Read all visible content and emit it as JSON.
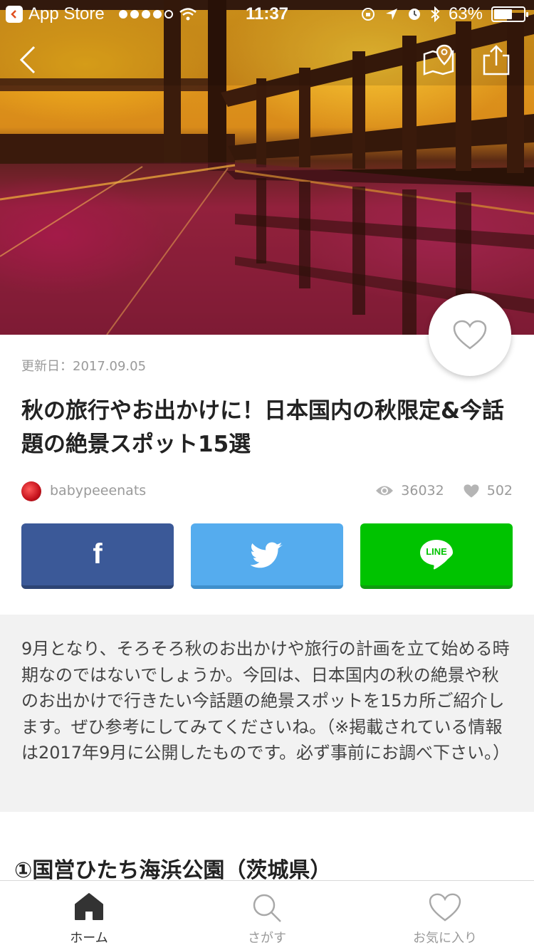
{
  "status_bar": {
    "carrier": "App Store",
    "time": "11:37",
    "battery": "63%",
    "battery_level": 0.63
  },
  "icons": {
    "back": "chevron-left-icon",
    "map": "map-pin-icon",
    "share": "share-icon",
    "favorite": "heart-icon"
  },
  "article": {
    "updated": "更新日：2017.09.05",
    "title": "秋の旅行やお出かけに！日本国内の秋限定&今話題の絶景スポット15選",
    "author": "babypeeenats",
    "views": "36032",
    "likes": "502",
    "intro": "9月となり、そろそろ秋のお出かけや旅行の計画を立て始める時期なのではないでしょうか。今回は、日本国内の秋の絶景や秋のお出かけで行きたい今話題の絶景スポットを15カ所ご紹介します。ぜひ参考にしてみてくださいね。（※掲載されている情報は2017年9月に公開したものです。必ず事前にお調べ下さい。）",
    "section_title": "①国営ひたち海浜公園（茨城県）"
  },
  "share": {
    "facebook": "f",
    "line": "LINE",
    "colors": {
      "facebook": "#3b5998",
      "twitter": "#55acee",
      "line": "#00c300"
    }
  },
  "tabs": [
    {
      "label": "ホーム",
      "icon": "home-icon"
    },
    {
      "label": "さがす",
      "icon": "search-icon"
    },
    {
      "label": "お気に入り",
      "icon": "heart-icon"
    }
  ]
}
